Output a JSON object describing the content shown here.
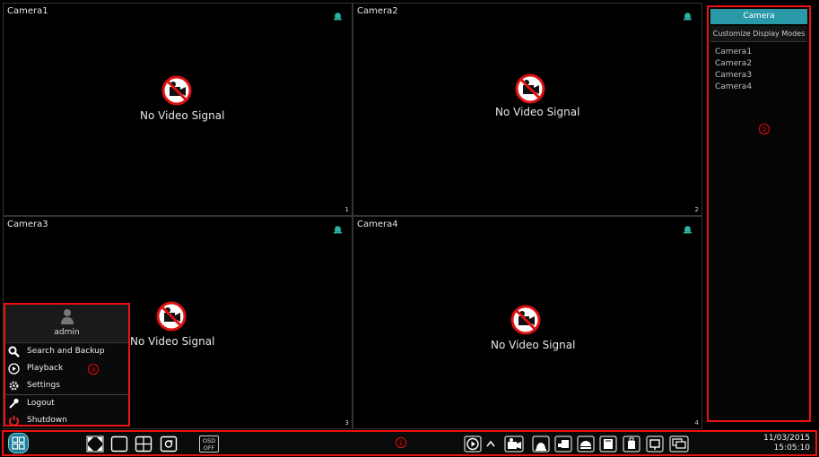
{
  "cameras": [
    {
      "name": "Camera1",
      "status": "No Video Signal",
      "channel": "1"
    },
    {
      "name": "Camera2",
      "status": "No Video Signal",
      "channel": "2"
    },
    {
      "name": "Camera3",
      "status": "No Video Signal",
      "channel": "3"
    },
    {
      "name": "Camera4",
      "status": "No Video Signal",
      "channel": "4"
    }
  ],
  "side_panel": {
    "header": "Camera",
    "mode_label": "Customize Display Modes",
    "items": [
      "Camera1",
      "Camera2",
      "Camera3",
      "Camera4"
    ]
  },
  "start_menu": {
    "username": "admin",
    "items": [
      "Search and Backup",
      "Playback",
      "Settings",
      "Logout",
      "Shutdown"
    ]
  },
  "toolbar": {
    "osd_line1": "OSD",
    "osd_line2": "OFF",
    "date": "11/03/2015",
    "time": "15:05:10"
  },
  "markers": {
    "toolbar": "①",
    "side_panel": "②",
    "start_menu": "③"
  },
  "colors": {
    "accent": "#2a9aa9",
    "highlight": "#e11111"
  }
}
